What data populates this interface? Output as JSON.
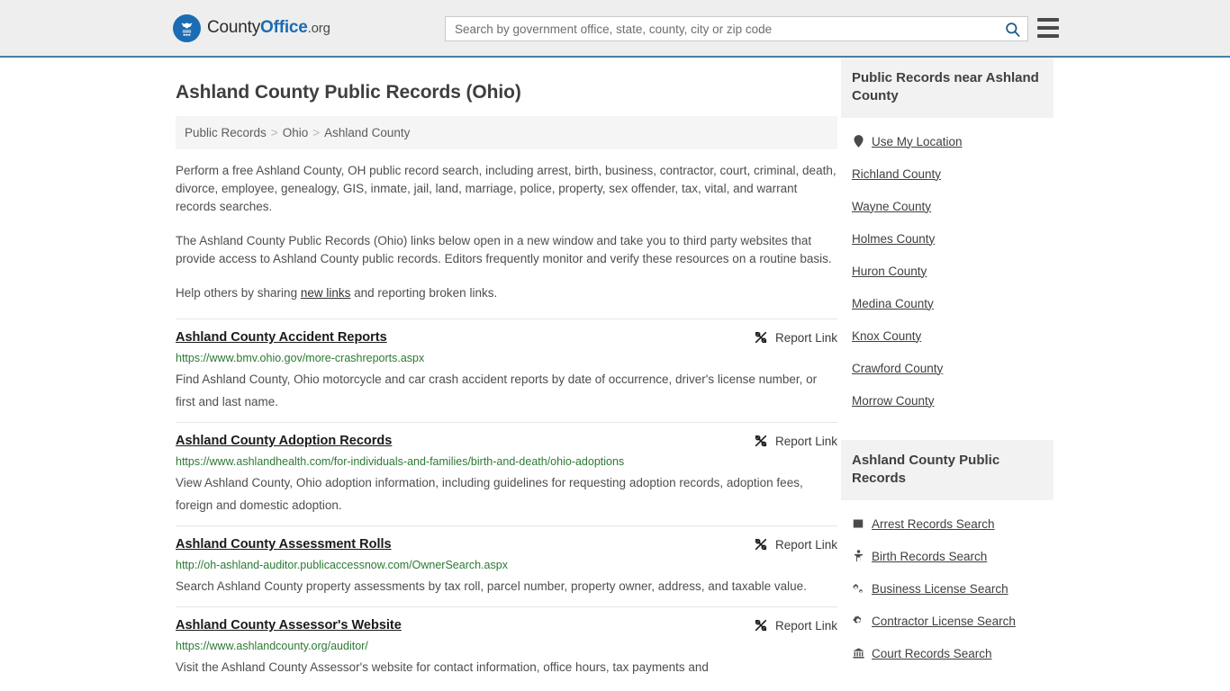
{
  "header": {
    "logo": {
      "part1": "County",
      "part2": "Office",
      "part3": ".org",
      "icon": "eagle-seal-icon"
    },
    "search": {
      "placeholder": "Search by government office, state, county, city or zip code",
      "value": "",
      "button_icon": "search-icon"
    },
    "menu_icon": "hamburger-menu-icon"
  },
  "main": {
    "page_title": "Ashland County Public Records (Ohio)",
    "breadcrumb": [
      {
        "label": "Public Records"
      },
      {
        "label": "Ohio"
      },
      {
        "label": "Ashland County"
      }
    ],
    "breadcrumb_separator": ">",
    "intro_paragraph_1": "Perform a free Ashland County, OH public record search, including arrest, birth, business, contractor, court, criminal, death, divorce, employee, genealogy, GIS, inmate, jail, land, marriage, police, property, sex offender, tax, vital, and warrant records searches.",
    "intro_paragraph_2": "The Ashland County Public Records (Ohio) links below open in a new window and take you to third party websites that provide access to Ashland County public records. Editors frequently monitor and verify these resources on a routine basis.",
    "help_prefix": "Help others by sharing ",
    "help_link": "new links",
    "help_suffix": " and reporting broken links.",
    "report_link_label": "Report Link",
    "report_link_icon": "broken-link-icon",
    "results": [
      {
        "title": "Ashland County Accident Reports",
        "url": "https://www.bmv.ohio.gov/more-crashreports.aspx",
        "description": "Find Ashland County, Ohio motorcycle and car crash accident reports by date of occurrence, driver's license number, or first and last name."
      },
      {
        "title": "Ashland County Adoption Records",
        "url": "https://www.ashlandhealth.com/for-individuals-and-families/birth-and-death/ohio-adoptions",
        "description": "View Ashland County, Ohio adoption information, including guidelines for requesting adoption records, adoption fees, foreign and domestic adoption."
      },
      {
        "title": "Ashland County Assessment Rolls",
        "url": "http://oh-ashland-auditor.publicaccessnow.com/OwnerSearch.aspx",
        "description": "Search Ashland County property assessments by tax roll, parcel number, property owner, address, and taxable value."
      },
      {
        "title": "Ashland County Assessor's Website",
        "url": "https://www.ashlandcounty.org/auditor/",
        "description": "Visit the Ashland County Assessor's website for contact information, office hours, tax payments and"
      }
    ]
  },
  "sidebar": {
    "near_box": {
      "title": "Public Records near Ashland County",
      "items": [
        {
          "label": "Use My Location",
          "icon": "map-pin-icon"
        },
        {
          "label": "Richland County",
          "icon": ""
        },
        {
          "label": "Wayne County",
          "icon": ""
        },
        {
          "label": "Holmes County",
          "icon": ""
        },
        {
          "label": "Huron County",
          "icon": ""
        },
        {
          "label": "Medina County",
          "icon": ""
        },
        {
          "label": "Knox County",
          "icon": ""
        },
        {
          "label": "Crawford County",
          "icon": ""
        },
        {
          "label": "Morrow County",
          "icon": ""
        }
      ]
    },
    "records_box": {
      "title": "Ashland County Public Records",
      "items": [
        {
          "label": "Arrest Records Search",
          "icon": "building-icon"
        },
        {
          "label": "Birth Records Search",
          "icon": "baby-icon"
        },
        {
          "label": "Business License Search",
          "icon": "cogs-icon"
        },
        {
          "label": "Contractor License Search",
          "icon": "gear-icon"
        },
        {
          "label": "Court Records Search",
          "icon": "courthouse-icon"
        }
      ]
    }
  },
  "colors": {
    "brand_blue": "#1b6cb3",
    "header_bg": "#eeeeee",
    "header_border": "#4a7fa5",
    "url_green": "#2c7a33",
    "panel_gray": "#f2f2f2"
  }
}
